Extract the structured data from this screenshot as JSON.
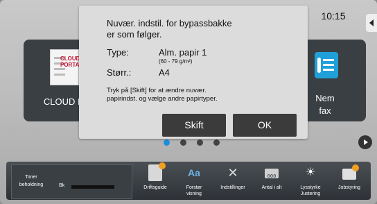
{
  "home": {
    "clock": "10:15",
    "tiles": {
      "left_label": "CLOUD POR",
      "cloud_logo_text": "CLOUD PORTAL",
      "right_label_line1": "Nem",
      "right_label_line2": "fax"
    },
    "page_dots": {
      "count": 4,
      "active": 0
    }
  },
  "dialog": {
    "message_line1": "Nuvær. indstil. for bypassbakke",
    "message_line2": "er som følger.",
    "type_label": "Type:",
    "type_value": "Alm. papir 1",
    "type_weight": "(60 - 79 g/m²)",
    "size_label": "Størr.:",
    "size_value": "A4",
    "hint_line1": "Tryk på [Skift] for at ændre nuvær.",
    "hint_line2": "papirindst. og vælge andre papirtyper.",
    "skift_label": "Skift",
    "ok_label": "OK"
  },
  "bottom_bar": {
    "toner": {
      "label_line1": "Toner",
      "label_line2": "beholdning",
      "color_label": "Bk"
    },
    "items": [
      {
        "label": "Driftsguide",
        "icon": "guide-icon"
      },
      {
        "label": "Forstør visning",
        "icon": "magnify-text-icon"
      },
      {
        "label": "Indstillinger",
        "icon": "settings-tools-icon"
      },
      {
        "label": "Antal i alt",
        "icon": "counter-icon",
        "icon_text": "000"
      },
      {
        "label": "Lysstyrke Justering",
        "icon": "brightness-icon"
      },
      {
        "label": "Jobstyring",
        "icon": "job-status-icon"
      }
    ]
  }
}
